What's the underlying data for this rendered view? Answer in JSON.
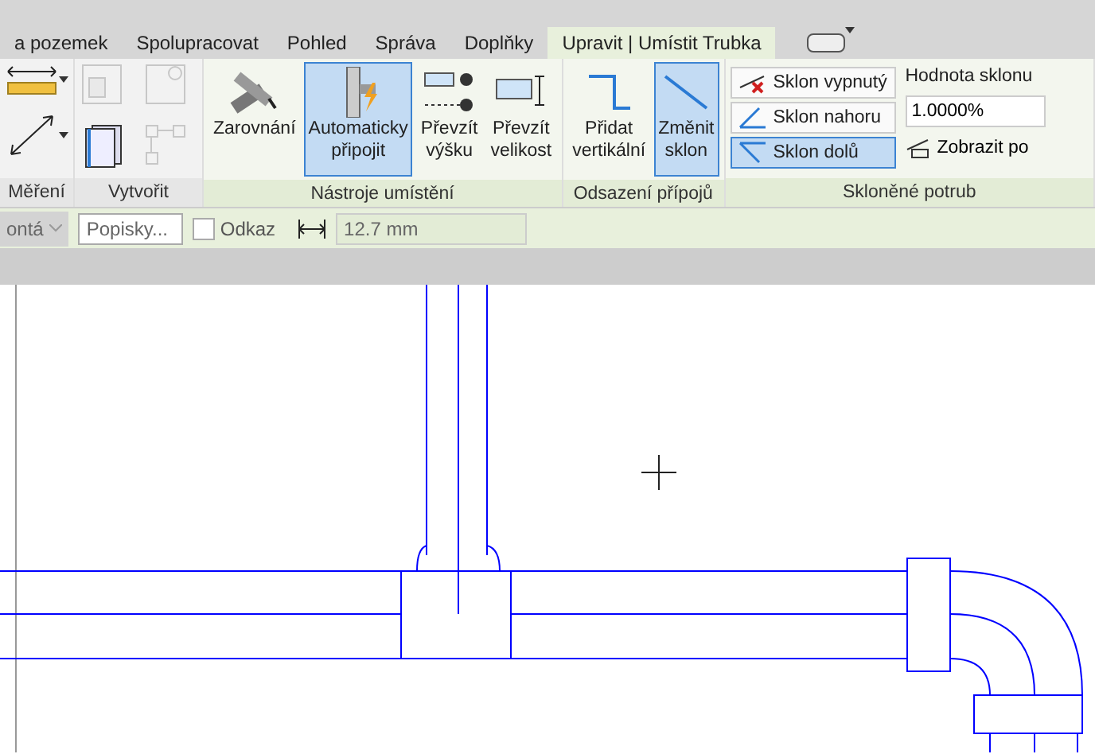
{
  "tabs": [
    {
      "label": "a pozemek",
      "selected": false
    },
    {
      "label": "Spolupracovat",
      "selected": false
    },
    {
      "label": "Pohled",
      "selected": false
    },
    {
      "label": "Správa",
      "selected": false
    },
    {
      "label": "Doplňky",
      "selected": false
    },
    {
      "label": "Upravit | Umístit Trubka",
      "selected": true
    }
  ],
  "panels": [
    {
      "label": "Měření",
      "tools": [
        {
          "kind": "icon",
          "disabled": false
        },
        {
          "kind": "icon",
          "disabled": false
        }
      ]
    },
    {
      "label": "Vytvořit",
      "tools": [
        {
          "kind": "icon",
          "disabled": true
        },
        {
          "kind": "icon",
          "disabled": true
        },
        {
          "kind": "icon",
          "disabled": false
        },
        {
          "kind": "icon",
          "disabled": true
        }
      ]
    },
    {
      "label": "Nástroje umístění",
      "tools": [
        {
          "kind": "large",
          "label": "Zarovnání",
          "selected": false
        },
        {
          "kind": "large",
          "label": "Automaticky připojit",
          "selected": true
        },
        {
          "kind": "large",
          "label": "Převzít výšku",
          "selected": false
        },
        {
          "kind": "large",
          "label": "Převzít velikost",
          "selected": false
        }
      ]
    },
    {
      "label": "Odsazení přípojů",
      "tools": [
        {
          "kind": "large",
          "label": "Přidat vertikální",
          "selected": false
        },
        {
          "kind": "large",
          "label": "Změnit sklon",
          "selected": true
        }
      ]
    },
    {
      "label": "Skloněné potrub",
      "tools": [
        {
          "kind": "small",
          "label": "Sklon vypnutý",
          "selected": false
        },
        {
          "kind": "small",
          "label": "Sklon nahoru",
          "selected": false
        },
        {
          "kind": "small",
          "label": "Sklon dolů",
          "selected": true
        },
        {
          "kind": "caption",
          "label": "Hodnota sklonu"
        },
        {
          "kind": "field",
          "value": "1.0000%"
        },
        {
          "kind": "link",
          "label": "Zobrazit po"
        }
      ]
    }
  ],
  "options_bar": {
    "dropdown": "ontá",
    "tag_field": "Popisky...",
    "reference": {
      "label": "Odkaz",
      "checked": false
    },
    "offset_value": "12.7 mm"
  }
}
